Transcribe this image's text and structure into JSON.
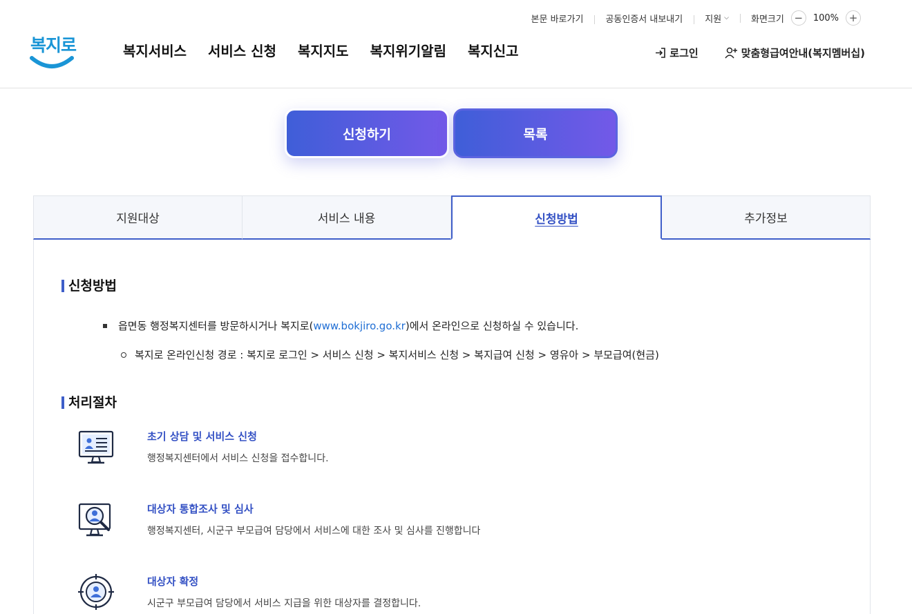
{
  "util": {
    "skip": "본문 바로가기",
    "cert": "공동인증서 내보내기",
    "support": "지원",
    "zoom_label": "화면크기",
    "zoom_value": "100%"
  },
  "logo": {
    "text": "복지로"
  },
  "gnb": [
    "복지서비스",
    "서비스 신청",
    "복지지도",
    "복지위기알림",
    "복지신고"
  ],
  "header_right": {
    "login": "로그인",
    "membership": "맞춤형급여안내(복지멤버십)"
  },
  "actions": {
    "apply": "신청하기",
    "list": "목록"
  },
  "tabs": [
    "지원대상",
    "서비스 내용",
    "신청방법",
    "추가정보"
  ],
  "active_tab": "신청방법",
  "method": {
    "title": "신청방법",
    "bullet_pre": "읍면동 행정복지센터를 방문하시거나 복지로(",
    "bullet_link": "www.bokjiro.go.kr",
    "bullet_post": ")에서 온라인으로 신청하실 수 있습니다.",
    "sub_bullet": "복지로 온라인신청 경로 : 복지로 로그인 > 서비스 신청 > 복지서비스 신청 > 복지급여 신청 > 영유아 > 부모급여(현금)"
  },
  "process": {
    "title": "처리절차",
    "steps": [
      {
        "title": "초기 상담 및 서비스 신청",
        "desc": "행정복지센터에서 서비스 신청을 접수합니다.",
        "icon": "monitor-document-icon"
      },
      {
        "title": "대상자 통합조사 및 심사",
        "desc": "행정복지센터, 시군구 부모급여 담당에서 서비스에 대한 조사 및 심사를 진행합니다",
        "icon": "monitor-search-icon"
      },
      {
        "title": "대상자 확정",
        "desc": "시군구 부모급여 담당에서 서비스 지급을 위한 대상자를 결정합니다.",
        "icon": "target-user-icon"
      }
    ]
  },
  "colors": {
    "accent": "#3e5ec9",
    "button_start": "#3f5ed8",
    "button_end": "#7359e8",
    "logo": "#1a95d6",
    "link": "#1f6ed4"
  }
}
